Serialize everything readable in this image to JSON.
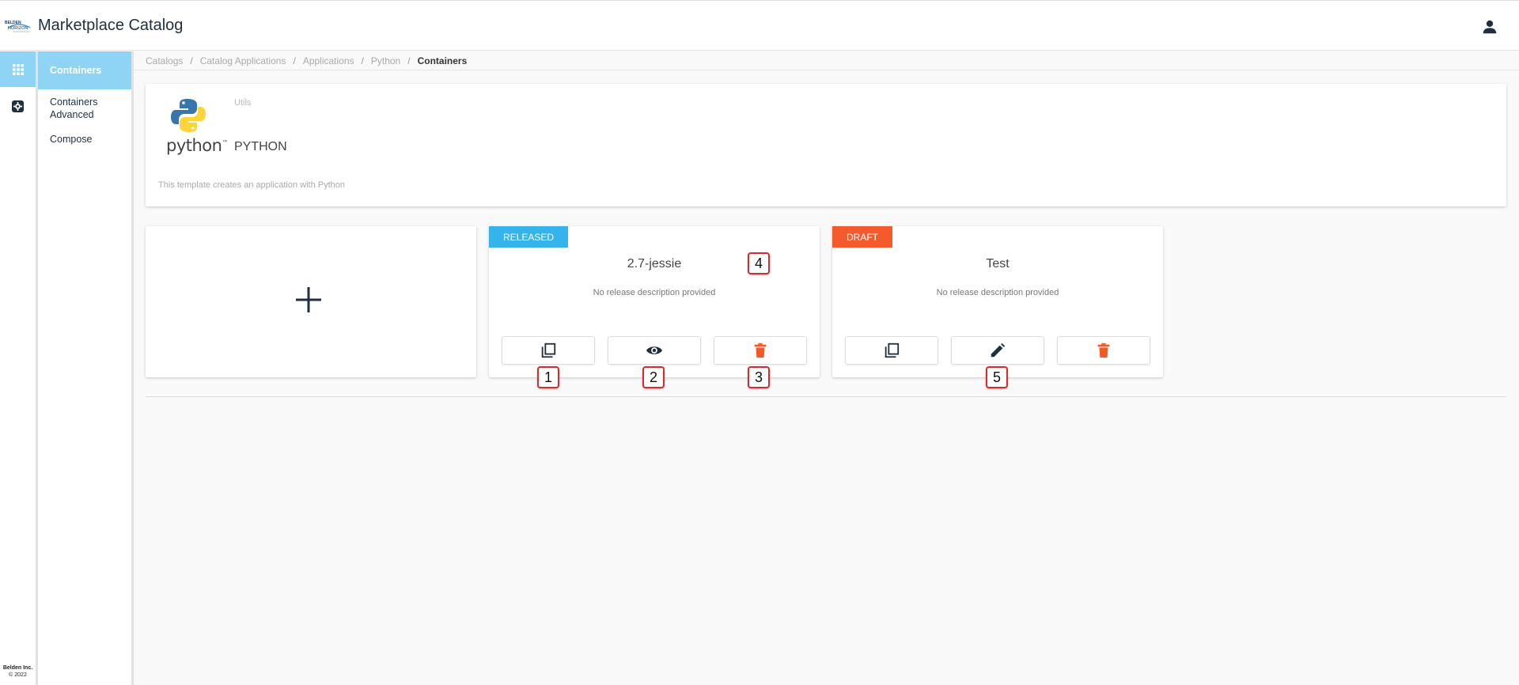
{
  "header": {
    "app_title": "Marketplace Catalog",
    "logo_alt": "BELDEN HORIZON",
    "user_icon": "user-icon"
  },
  "rail": {
    "items": [
      {
        "icon": "grid-icon",
        "active": true
      },
      {
        "icon": "settings-gear-icon",
        "active": false
      }
    ],
    "footer_line1": "Belden Inc.",
    "footer_line2": "© 2022"
  },
  "subnav": {
    "items": [
      {
        "label": "Containers"
      },
      {
        "label": "Containers Advanced"
      },
      {
        "label": "Compose"
      }
    ]
  },
  "breadcrumb": {
    "items": [
      "Catalogs",
      "Catalog Applications",
      "Applications",
      "Python"
    ],
    "separator": "/",
    "current": "Containers"
  },
  "app": {
    "category": "Utils",
    "logo_word": "python",
    "logo_tm": "™",
    "name": "PYTHON",
    "description": "This template creates an application with Python"
  },
  "add_card": {
    "icon": "plus-icon"
  },
  "versions": [
    {
      "status": "RELEASED",
      "status_color": "#34b4eb",
      "title": "2.7-jessie",
      "description": "No release description provided",
      "actions": [
        "copy-icon",
        "eye-icon",
        "trash-icon"
      ]
    },
    {
      "status": "DRAFT",
      "status_color": "#f55a2c",
      "title": "Test",
      "description": "No release description provided",
      "actions": [
        "copy-icon",
        "pencil-icon",
        "trash-icon"
      ]
    }
  ],
  "markers": [
    "1",
    "2",
    "3",
    "4",
    "5"
  ],
  "colors": {
    "accent": "#8fd3f5",
    "released": "#34b4eb",
    "draft": "#f55a2c",
    "danger_icon": "#f05a28",
    "dark_icon": "#1f2f3d"
  }
}
